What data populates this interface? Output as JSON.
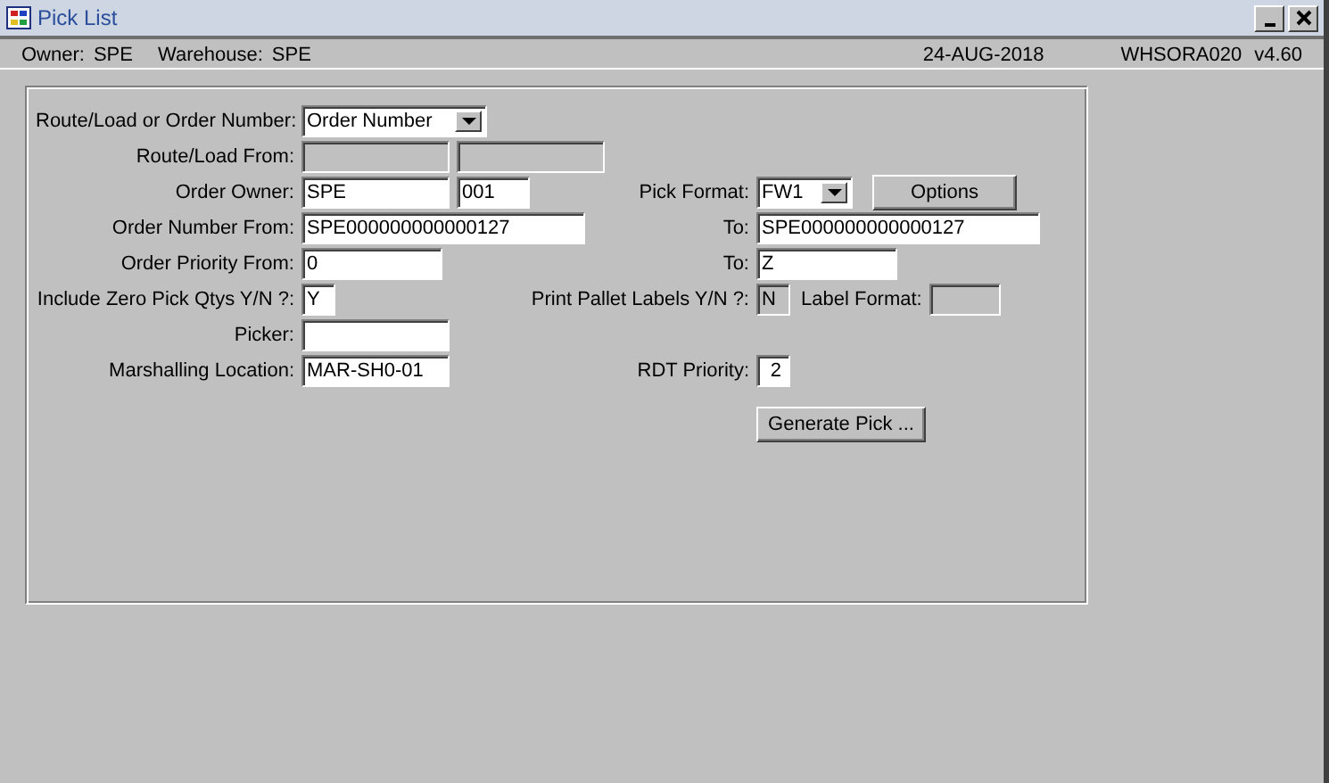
{
  "window": {
    "title": "Pick List"
  },
  "header": {
    "owner_label": "Owner:",
    "owner": "SPE",
    "warehouse_label": "Warehouse:",
    "warehouse": "SPE",
    "date": "24-AUG-2018",
    "program": "WHSORA020",
    "version": "v4.60"
  },
  "rows": [
    {
      "label": "Route/Load or Order Number:",
      "fields": [
        {
          "kind": "select",
          "value": "Order Number",
          "disabled": false
        }
      ]
    },
    {
      "label": "Route/Load From:",
      "fields": [
        {
          "kind": "text",
          "disabled": true
        },
        {
          "kind": "text",
          "disabled": true
        }
      ]
    },
    {
      "label": "Order Owner:",
      "fields": [
        {
          "kind": "text",
          "value": "SPE",
          "disabled": false
        },
        {
          "kind": "text",
          "value": "001",
          "disabled": false
        }
      ],
      "right": {
        "label": "Pick Format:",
        "fields": [
          {
            "kind": "select",
            "value": "FW1",
            "disabled": false
          },
          {
            "kind": "button",
            "value": "Options"
          }
        ]
      }
    },
    {
      "label": "Order Number From:",
      "fields": [
        {
          "kind": "text",
          "value": "SPE000000000000127",
          "disabled": false
        }
      ],
      "right": {
        "label": "To:",
        "fields": [
          {
            "kind": "text",
            "value": "SPE000000000000127",
            "disabled": false
          }
        ]
      }
    },
    {
      "label": "Order Priority From:",
      "fields": [
        {
          "kind": "text",
          "value": "0",
          "disabled": false
        }
      ],
      "right": {
        "label": "To:",
        "fields": [
          {
            "kind": "text",
            "value": "Z",
            "disabled": false
          }
        ]
      }
    },
    {
      "label": "Include Zero Pick Qtys Y/N ?:",
      "fields": [
        {
          "kind": "text",
          "value": "Y",
          "disabled": false
        }
      ],
      "right": {
        "label": "Print Pallet Labels Y/N ?:",
        "fields": [
          {
            "kind": "text",
            "value": "N",
            "disabled": true
          },
          {
            "kind": "label",
            "value": "Label Format:"
          },
          {
            "kind": "text",
            "disabled": true
          }
        ]
      }
    },
    {
      "label": "Picker:",
      "fields": [
        {
          "kind": "text",
          "disabled": false
        }
      ]
    },
    {
      "label": "Marshalling Location:",
      "fields": [
        {
          "kind": "text",
          "value": "MAR-SH0-01",
          "disabled": false
        }
      ],
      "right": {
        "label": "RDT Priority:",
        "fields": [
          {
            "kind": "number",
            "value": "2",
            "disabled": false
          }
        ]
      }
    },
    {
      "right": {
        "fields": [
          {
            "kind": "button",
            "value": "Generate Pick ..."
          }
        ]
      }
    }
  ]
}
